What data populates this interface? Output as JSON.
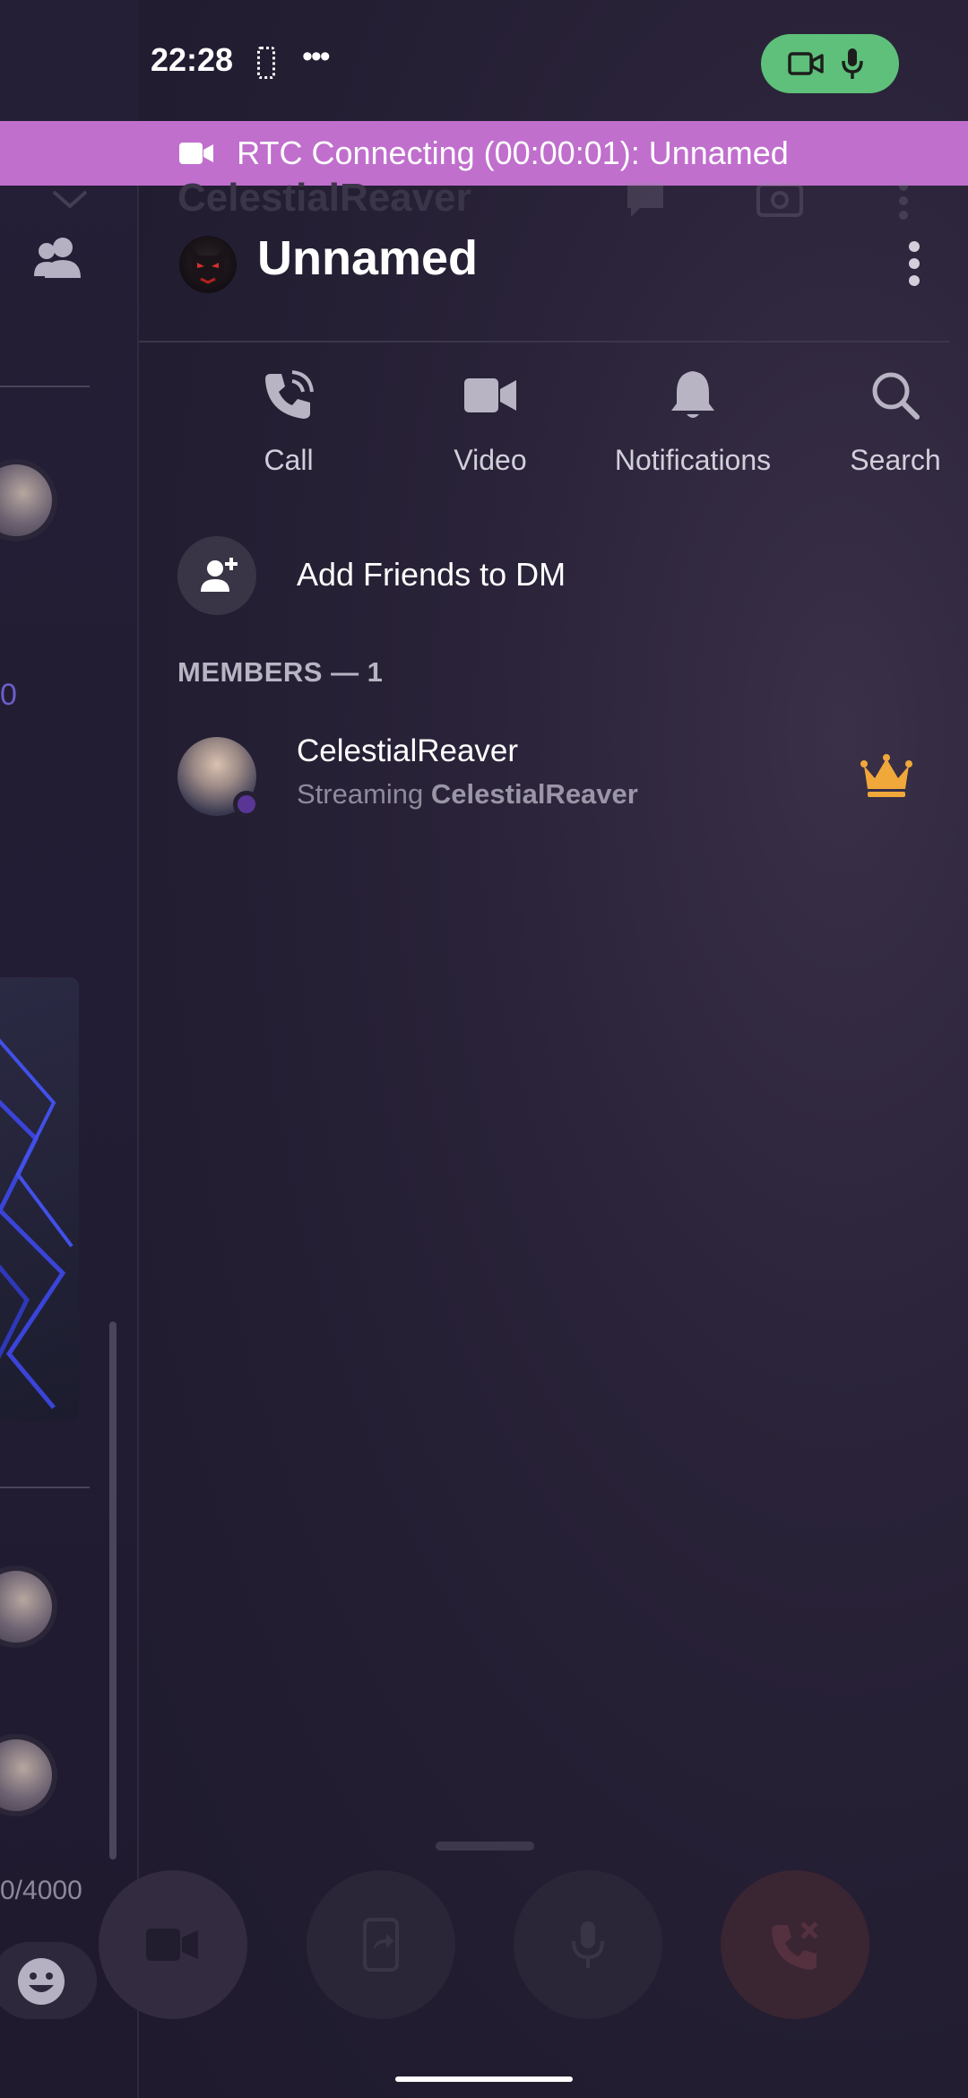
{
  "status_bar": {
    "time": "22:28",
    "dots": "•••"
  },
  "rtc_banner": {
    "text": "RTC Connecting (00:00:01): Unnamed"
  },
  "background": {
    "ghost_title": "CelestialReaver",
    "left_purple_text": "0",
    "char_counter": "0/4000"
  },
  "drawer": {
    "title": "Unnamed",
    "actions": [
      {
        "label": "Call",
        "icon": "phone-call-icon"
      },
      {
        "label": "Video",
        "icon": "video-camera-icon"
      },
      {
        "label": "Notifications",
        "icon": "bell-icon"
      },
      {
        "label": "Search",
        "icon": "search-icon"
      }
    ],
    "add_friends_label": "Add Friends to DM",
    "members_header": "MEMBERS — 1",
    "members": [
      {
        "name": "CelestialReaver",
        "status_prefix": "Streaming",
        "status_target": "CelestialReaver",
        "badge": "crown-icon"
      }
    ]
  },
  "colors": {
    "banner": "#c06fcd",
    "call_pill": "#5ec07a",
    "crown": "#f0a83a",
    "background": "#1f1a2e"
  }
}
